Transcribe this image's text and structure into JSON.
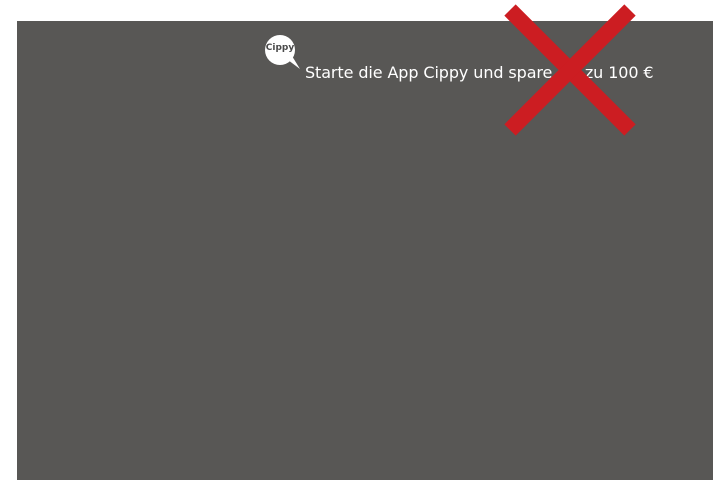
{
  "ad": {
    "logo_text": "Cippy",
    "promo_text": "Starte die App Cippy und spare bis zu 100 €"
  },
  "colors": {
    "banner_background": "#585755",
    "close_icon": "#cc1d22",
    "text": "#ffffff"
  },
  "icons": {
    "logo": "speech-bubble-icon",
    "close": "close-x-icon"
  }
}
